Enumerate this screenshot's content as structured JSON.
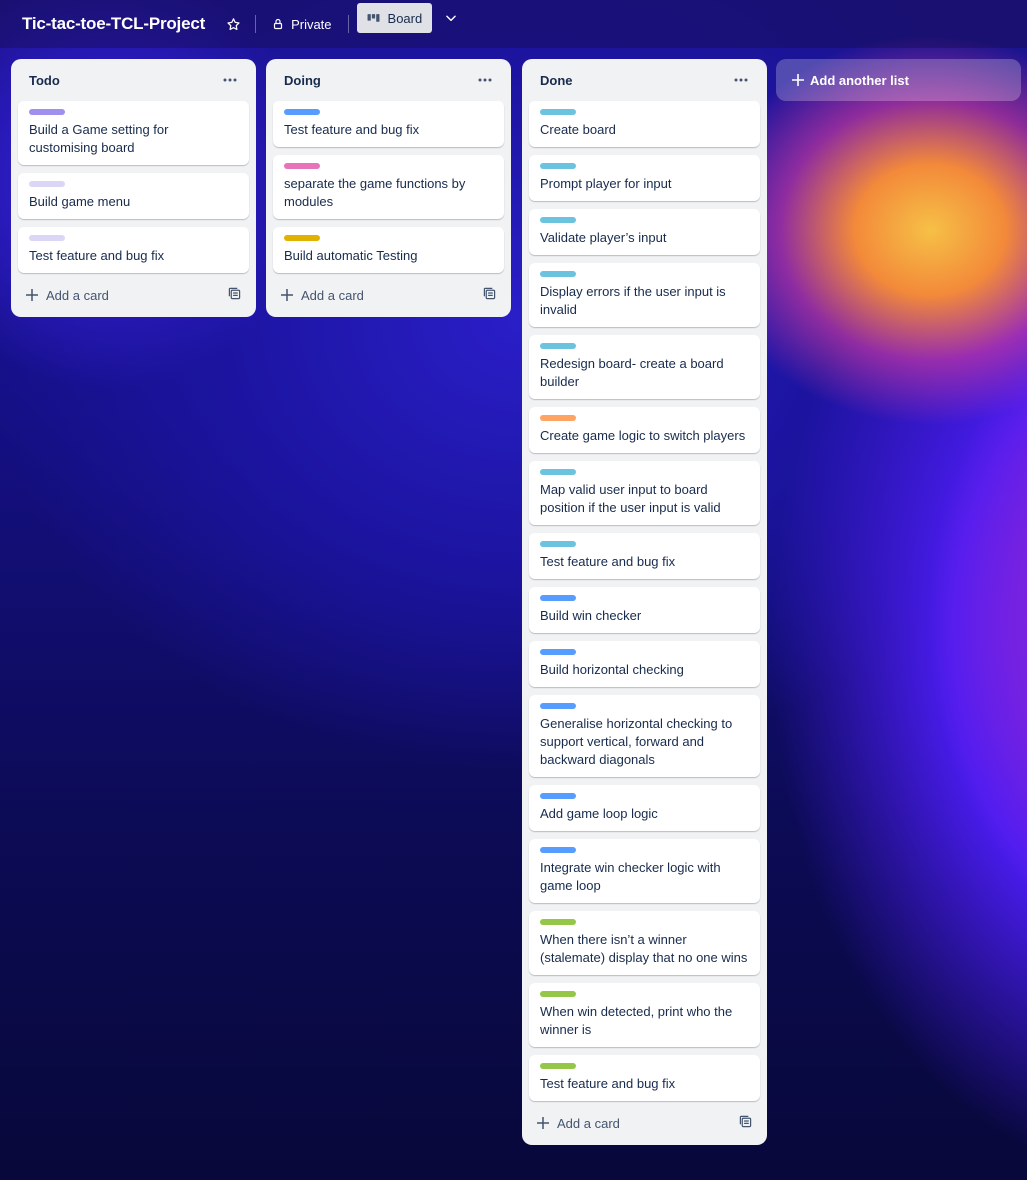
{
  "header": {
    "board_title": "Tic-tac-toe-TCL-Project",
    "visibility_label": "Private",
    "view_label": "Board"
  },
  "colors": {
    "purple": "#9f8fef",
    "light_purple": "#dcd6f6",
    "blue": "#579dff",
    "pink": "#e774bb",
    "yellow": "#e2b203",
    "teal": "#6cc3e0",
    "orange": "#fea362",
    "green": "#94c748"
  },
  "lists": [
    {
      "title": "Todo",
      "add_card_label": "Add a card",
      "cards": [
        {
          "label_color": "#9f8fef",
          "text": "Build a Game setting for customising board"
        },
        {
          "label_color": "#dcd6f6",
          "text": "Build game menu"
        },
        {
          "label_color": "#dcd6f6",
          "text": "Test feature and bug fix"
        }
      ]
    },
    {
      "title": "Doing",
      "add_card_label": "Add a card",
      "cards": [
        {
          "label_color": "#579dff",
          "text": "Test feature and bug fix"
        },
        {
          "label_color": "#e774bb",
          "text": "separate the game functions by modules"
        },
        {
          "label_color": "#e2b203",
          "text": "Build automatic Testing"
        }
      ]
    },
    {
      "title": "Done",
      "add_card_label": "Add a card",
      "cards": [
        {
          "label_color": "#6cc3e0",
          "text": "Create board"
        },
        {
          "label_color": "#6cc3e0",
          "text": "Prompt player for input"
        },
        {
          "label_color": "#6cc3e0",
          "text": "Validate player’s input"
        },
        {
          "label_color": "#6cc3e0",
          "text": "Display errors if the user input is invalid"
        },
        {
          "label_color": "#6cc3e0",
          "text": "Redesign board- create a board builder"
        },
        {
          "label_color": "#fea362",
          "text": "Create game logic to switch players"
        },
        {
          "label_color": "#6cc3e0",
          "text": "Map valid user input to board position if the user input is valid"
        },
        {
          "label_color": "#6cc3e0",
          "text": "Test feature and bug fix"
        },
        {
          "label_color": "#579dff",
          "text": "Build win checker"
        },
        {
          "label_color": "#579dff",
          "text": "Build horizontal checking"
        },
        {
          "label_color": "#579dff",
          "text": "Generalise horizontal checking to support vertical, forward and backward diagonals"
        },
        {
          "label_color": "#579dff",
          "text": "Add game loop logic"
        },
        {
          "label_color": "#579dff",
          "text": "Integrate win checker logic with game loop"
        },
        {
          "label_color": "#94c748",
          "text": "When there isn’t a winner (stalemate) display that no one wins"
        },
        {
          "label_color": "#94c748",
          "text": "When win detected, print who the winner is"
        },
        {
          "label_color": "#94c748",
          "text": "Test feature and bug fix"
        }
      ]
    }
  ],
  "add_list_label": "Add another list"
}
